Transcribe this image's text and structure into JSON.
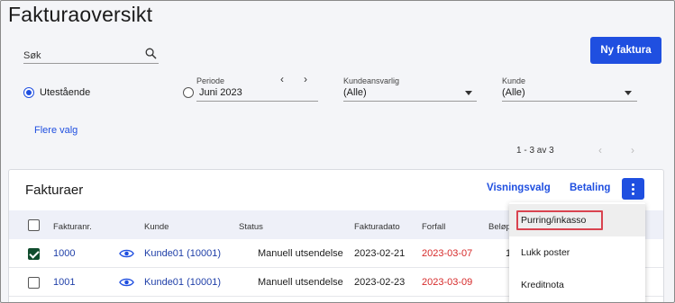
{
  "page": {
    "title": "Fakturaoversikt"
  },
  "toolbar": {
    "new_invoice_label": "Ny faktura"
  },
  "search": {
    "placeholder": "Søk",
    "icon": "search-icon"
  },
  "filters": {
    "outstanding_label": "Utestående",
    "outstanding_selected": true,
    "period_label": "Periode",
    "period_value": "Juni 2023",
    "period_prev": "‹",
    "period_next": "›",
    "customer_manager_label": "Kundeansvarlig",
    "customer_manager_value": "(Alle)",
    "customer_label": "Kunde",
    "customer_value": "(Alle)",
    "more_options_label": "Flere valg"
  },
  "pager": {
    "text": "1 - 3 av 3",
    "prev": "‹",
    "next": "›"
  },
  "card": {
    "title": "Fakturaer",
    "view_options_label": "Visningsvalg",
    "payment_label": "Betaling"
  },
  "table": {
    "columns": [
      "Fakturanr.",
      "Kunde",
      "Status",
      "Fakturadato",
      "Forfall",
      "Beløp"
    ],
    "rows": [
      {
        "checked": true,
        "number": "1000",
        "customer": "Kunde01 (10001)",
        "status": "Manuell utsendelse",
        "invoice_date": "2023-02-21",
        "due_date": "2023-03-07",
        "amount": "1"
      },
      {
        "checked": false,
        "number": "1001",
        "customer": "Kunde01 (10001)",
        "status": "Manuell utsendelse",
        "invoice_date": "2023-02-23",
        "due_date": "2023-03-09",
        "amount": ""
      }
    ]
  },
  "menu": {
    "items": [
      "Purring/inkasso",
      "Lukk poster",
      "Kreditnota"
    ],
    "highlighted": "Purring/inkasso"
  },
  "colors": {
    "accent": "#1f4fe0",
    "overdue": "#d62a2a",
    "checked": "#114d2e",
    "highlight_border": "#d9434f"
  }
}
